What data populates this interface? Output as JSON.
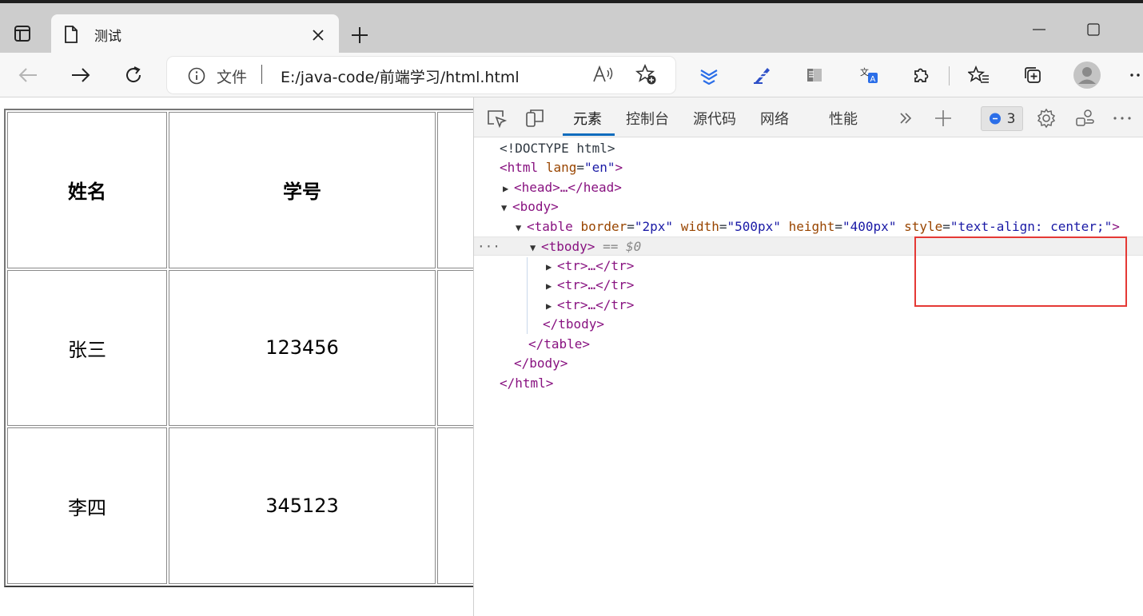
{
  "browser": {
    "tab": {
      "title": "测试"
    },
    "address": {
      "label": "文件",
      "url": "E:/java-code/前端学习/html.html"
    }
  },
  "page_table": {
    "headers": [
      "姓名",
      "学号"
    ],
    "rows": [
      [
        "张三",
        "123456"
      ],
      [
        "李四",
        "345123"
      ]
    ]
  },
  "devtools": {
    "tabs": [
      "元素",
      "控制台",
      "源代码",
      "网络",
      "性能"
    ],
    "active_tab": "元素",
    "issues_count": "3",
    "dom": {
      "doctype": "<!DOCTYPE html>",
      "html_open": "<html",
      "html_lang_attr": "lang",
      "html_lang_val": "\"en\"",
      "head": "<head>…</head>",
      "body_open": "<body>",
      "table_open": "<table",
      "table_attrs": [
        {
          "name": "border",
          "value": "\"2px\""
        },
        {
          "name": "width",
          "value": "\"500px\""
        },
        {
          "name": "height",
          "value": "\"400px\""
        },
        {
          "name": "style",
          "value": "\"text-align: center;\""
        }
      ],
      "tbody_open": "<tbody>",
      "selected_marker": "== $0",
      "tr_collapsed": "<tr>…</tr>",
      "tbody_close": "</tbody>",
      "table_close": "</table>",
      "body_close": "</body>",
      "html_close": "</html>"
    }
  },
  "colors": {
    "highlight": "#e53935",
    "devtools_active": "#0f6cbd"
  }
}
